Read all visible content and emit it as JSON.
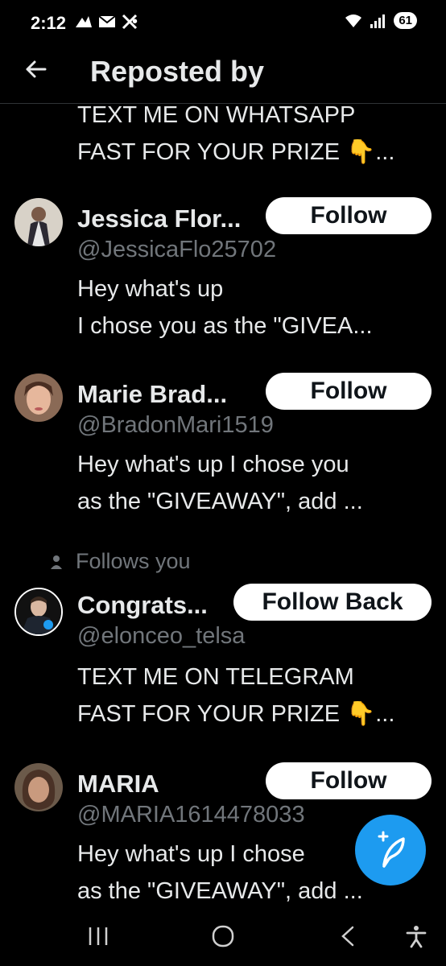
{
  "status": {
    "time": "2:12",
    "battery": "61"
  },
  "header": {
    "title": "Reposted by"
  },
  "top_bio": {
    "line1": "TEXT ME ON WHATSAPP",
    "line2": "FAST FOR YOUR PRIZE 👇..."
  },
  "users": [
    {
      "name": "Jessica Flor...",
      "handle": "@JessicaFlo25702",
      "follow_label": "Follow",
      "bio_line1": "Hey what's up",
      "bio_line2": "I chose you as the \"GIVEA..."
    },
    {
      "name": "Marie Brad...",
      "handle": "@BradonMari1519",
      "follow_label": "Follow",
      "bio_line1": "Hey what's up I chose you",
      "bio_line2": "as the \"GIVEAWAY\", add ..."
    },
    {
      "follows_you": "Follows you",
      "name": "Congrats...",
      "handle": "@elonceo_telsa",
      "follow_label": "Follow Back",
      "bio_line1": "TEXT ME ON TELEGRAM",
      "bio_line2": "FAST FOR YOUR PRIZE 👇..."
    },
    {
      "name": "MARIA",
      "handle": "@MARIA1614478033",
      "follow_label": "Follow",
      "bio_line1": "Hey what's up I chose",
      "bio_line2": "as the \"GIVEAWAY\", add ..."
    }
  ],
  "colors": {
    "accent": "#1d9bf0",
    "background": "#000000",
    "secondary_text": "#71767b"
  },
  "icons": [
    "back-arrow-icon",
    "compose-icon",
    "recents-icon",
    "home-icon",
    "back-nav-icon",
    "accessibility-icon",
    "person-icon"
  ]
}
